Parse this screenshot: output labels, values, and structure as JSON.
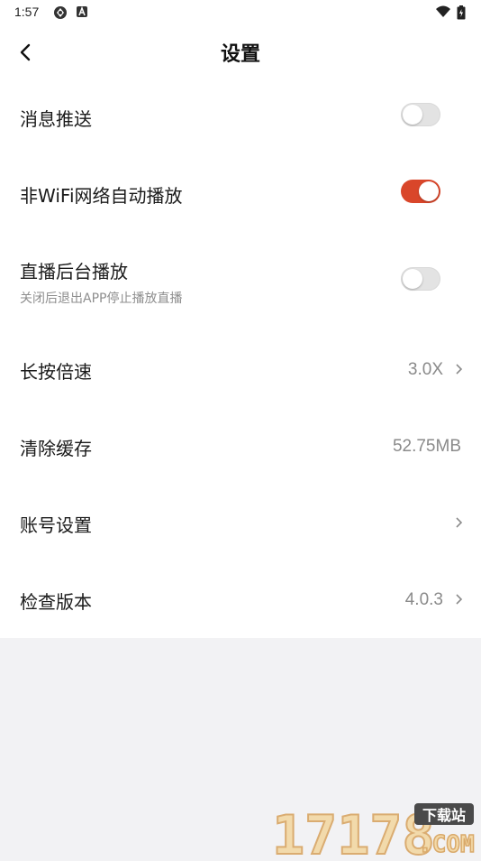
{
  "status_bar": {
    "time": "1:57",
    "left_icons": [
      "sync-icon",
      "app-a-icon"
    ],
    "right_icons": [
      "wifi-icon",
      "battery-icon"
    ]
  },
  "header": {
    "title": "设置",
    "back_icon": "back-arrow-icon"
  },
  "settings": {
    "push": {
      "label": "消息推送",
      "enabled": false
    },
    "wifi_autoplay": {
      "label": "非WiFi网络自动播放",
      "enabled": true
    },
    "live_background": {
      "label": "直播后台播放",
      "subtitle": "关闭后退出APP停止播放直播",
      "enabled": false
    },
    "long_press_speed": {
      "label": "长按倍速",
      "value": "3.0X"
    },
    "clear_cache": {
      "label": "清除缓存",
      "value": "52.75MB"
    },
    "account": {
      "label": "账号设置"
    },
    "check_version": {
      "label": "检查版本",
      "value": "4.0.3"
    }
  },
  "colors": {
    "accent": "#d9462a",
    "toggle_off": "#e3e3e3",
    "background": "#f2f2f4"
  },
  "watermark": {
    "brand_number": "17178",
    "tag": "下载站",
    "suffix": ".COM"
  }
}
